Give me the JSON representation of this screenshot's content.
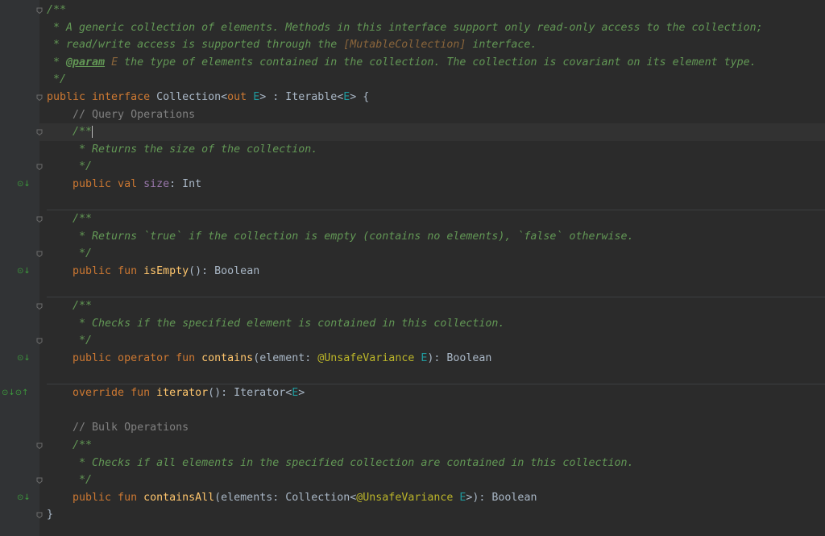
{
  "lines": [
    {
      "tokens": [
        [
          "doc",
          "/**"
        ]
      ]
    },
    {
      "tokens": [
        [
          "doc",
          " * A generic collection of elements. Methods in this interface support only read-only access to the collection;"
        ]
      ]
    },
    {
      "tokens": [
        [
          "doc",
          " * read/write access is supported through the "
        ],
        [
          "doclink",
          "[MutableCollection]"
        ],
        [
          "doc",
          " interface."
        ]
      ]
    },
    {
      "tokens": [
        [
          "doc",
          " * "
        ],
        [
          "doctag",
          "@param"
        ],
        [
          "doc",
          " "
        ],
        [
          "docparam",
          "E"
        ],
        [
          "doc",
          " the type of elements contained in the collection. The collection is covariant on its element type."
        ]
      ]
    },
    {
      "tokens": [
        [
          "doc",
          " */"
        ]
      ]
    },
    {
      "tokens": [
        [
          "kw",
          "public interface "
        ],
        [
          "",
          "Collection<"
        ],
        [
          "kw",
          "out "
        ],
        [
          "tp",
          "E"
        ],
        [
          "",
          "> : Iterable<"
        ],
        [
          "tp",
          "E"
        ],
        [
          "",
          "> {"
        ]
      ]
    },
    {
      "tokens": [
        [
          "cmt",
          "    // Query Operations"
        ]
      ]
    },
    {
      "tokens": [
        [
          "doc",
          "    /**"
        ]
      ],
      "caret": true
    },
    {
      "tokens": [
        [
          "doc",
          "     * Returns the size of the collection."
        ]
      ]
    },
    {
      "tokens": [
        [
          "doc",
          "     */"
        ]
      ]
    },
    {
      "tokens": [
        [
          "kw",
          "    public val "
        ],
        [
          "prop",
          "size"
        ],
        [
          "",
          ": Int"
        ]
      ]
    },
    {
      "tokens": []
    },
    {
      "tokens": [
        [
          "doc",
          "    /**"
        ]
      ]
    },
    {
      "tokens": [
        [
          "doc",
          "     * Returns `true` if the collection is empty (contains no elements), `false` otherwise."
        ]
      ]
    },
    {
      "tokens": [
        [
          "doc",
          "     */"
        ]
      ]
    },
    {
      "tokens": [
        [
          "kw",
          "    public fun "
        ],
        [
          "fn",
          "isEmpty"
        ],
        [
          "",
          "(): Boolean"
        ]
      ]
    },
    {
      "tokens": []
    },
    {
      "tokens": [
        [
          "doc",
          "    /**"
        ]
      ]
    },
    {
      "tokens": [
        [
          "doc",
          "     * Checks if the specified element is contained in this collection."
        ]
      ]
    },
    {
      "tokens": [
        [
          "doc",
          "     */"
        ]
      ]
    },
    {
      "tokens": [
        [
          "kw",
          "    public operator fun "
        ],
        [
          "fn",
          "contains"
        ],
        [
          "",
          "(element: "
        ],
        [
          "ann",
          "@UnsafeVariance "
        ],
        [
          "tp",
          "E"
        ],
        [
          "",
          "): Boolean"
        ]
      ]
    },
    {
      "tokens": []
    },
    {
      "tokens": [
        [
          "kw",
          "    override fun "
        ],
        [
          "fn",
          "iterator"
        ],
        [
          "",
          "(): Iterator<"
        ],
        [
          "tp",
          "E"
        ],
        [
          "",
          ">"
        ]
      ]
    },
    {
      "tokens": []
    },
    {
      "tokens": [
        [
          "cmt",
          "    // Bulk Operations"
        ]
      ]
    },
    {
      "tokens": [
        [
          "doc",
          "    /**"
        ]
      ]
    },
    {
      "tokens": [
        [
          "doc",
          "     * Checks if all elements in the specified collection are contained in this collection."
        ]
      ]
    },
    {
      "tokens": [
        [
          "doc",
          "     */"
        ]
      ]
    },
    {
      "tokens": [
        [
          "kw",
          "    public fun "
        ],
        [
          "fn",
          "containsAll"
        ],
        [
          "",
          "(elements: Collection<"
        ],
        [
          "ann",
          "@UnsafeVariance "
        ],
        [
          "tp",
          "E"
        ],
        [
          "",
          ">): Boolean"
        ]
      ]
    },
    {
      "tokens": [
        [
          "",
          "}"
        ]
      ]
    }
  ],
  "gutter_icons": [
    {
      "line": 10,
      "icon": "implemented-down-icon",
      "glyph": "⊙↓",
      "color": "#3d9c3d"
    },
    {
      "line": 15,
      "icon": "implemented-down-icon",
      "glyph": "⊙↓",
      "color": "#3d9c3d"
    },
    {
      "line": 20,
      "icon": "implemented-down-icon",
      "glyph": "⊙↓",
      "color": "#3d9c3d"
    },
    {
      "line": 22,
      "icon": "implemented-and-overrides-icon",
      "glyph": "⊙↓⊙↑",
      "color": "#3d9c3d"
    },
    {
      "line": 28,
      "icon": "implemented-down-icon",
      "glyph": "⊙↓",
      "color": "#3d9c3d"
    }
  ],
  "fold_lines": [
    0,
    5,
    7,
    9,
    12,
    14,
    17,
    19,
    25,
    27,
    29
  ],
  "separators_after": [
    10,
    15,
    20
  ]
}
